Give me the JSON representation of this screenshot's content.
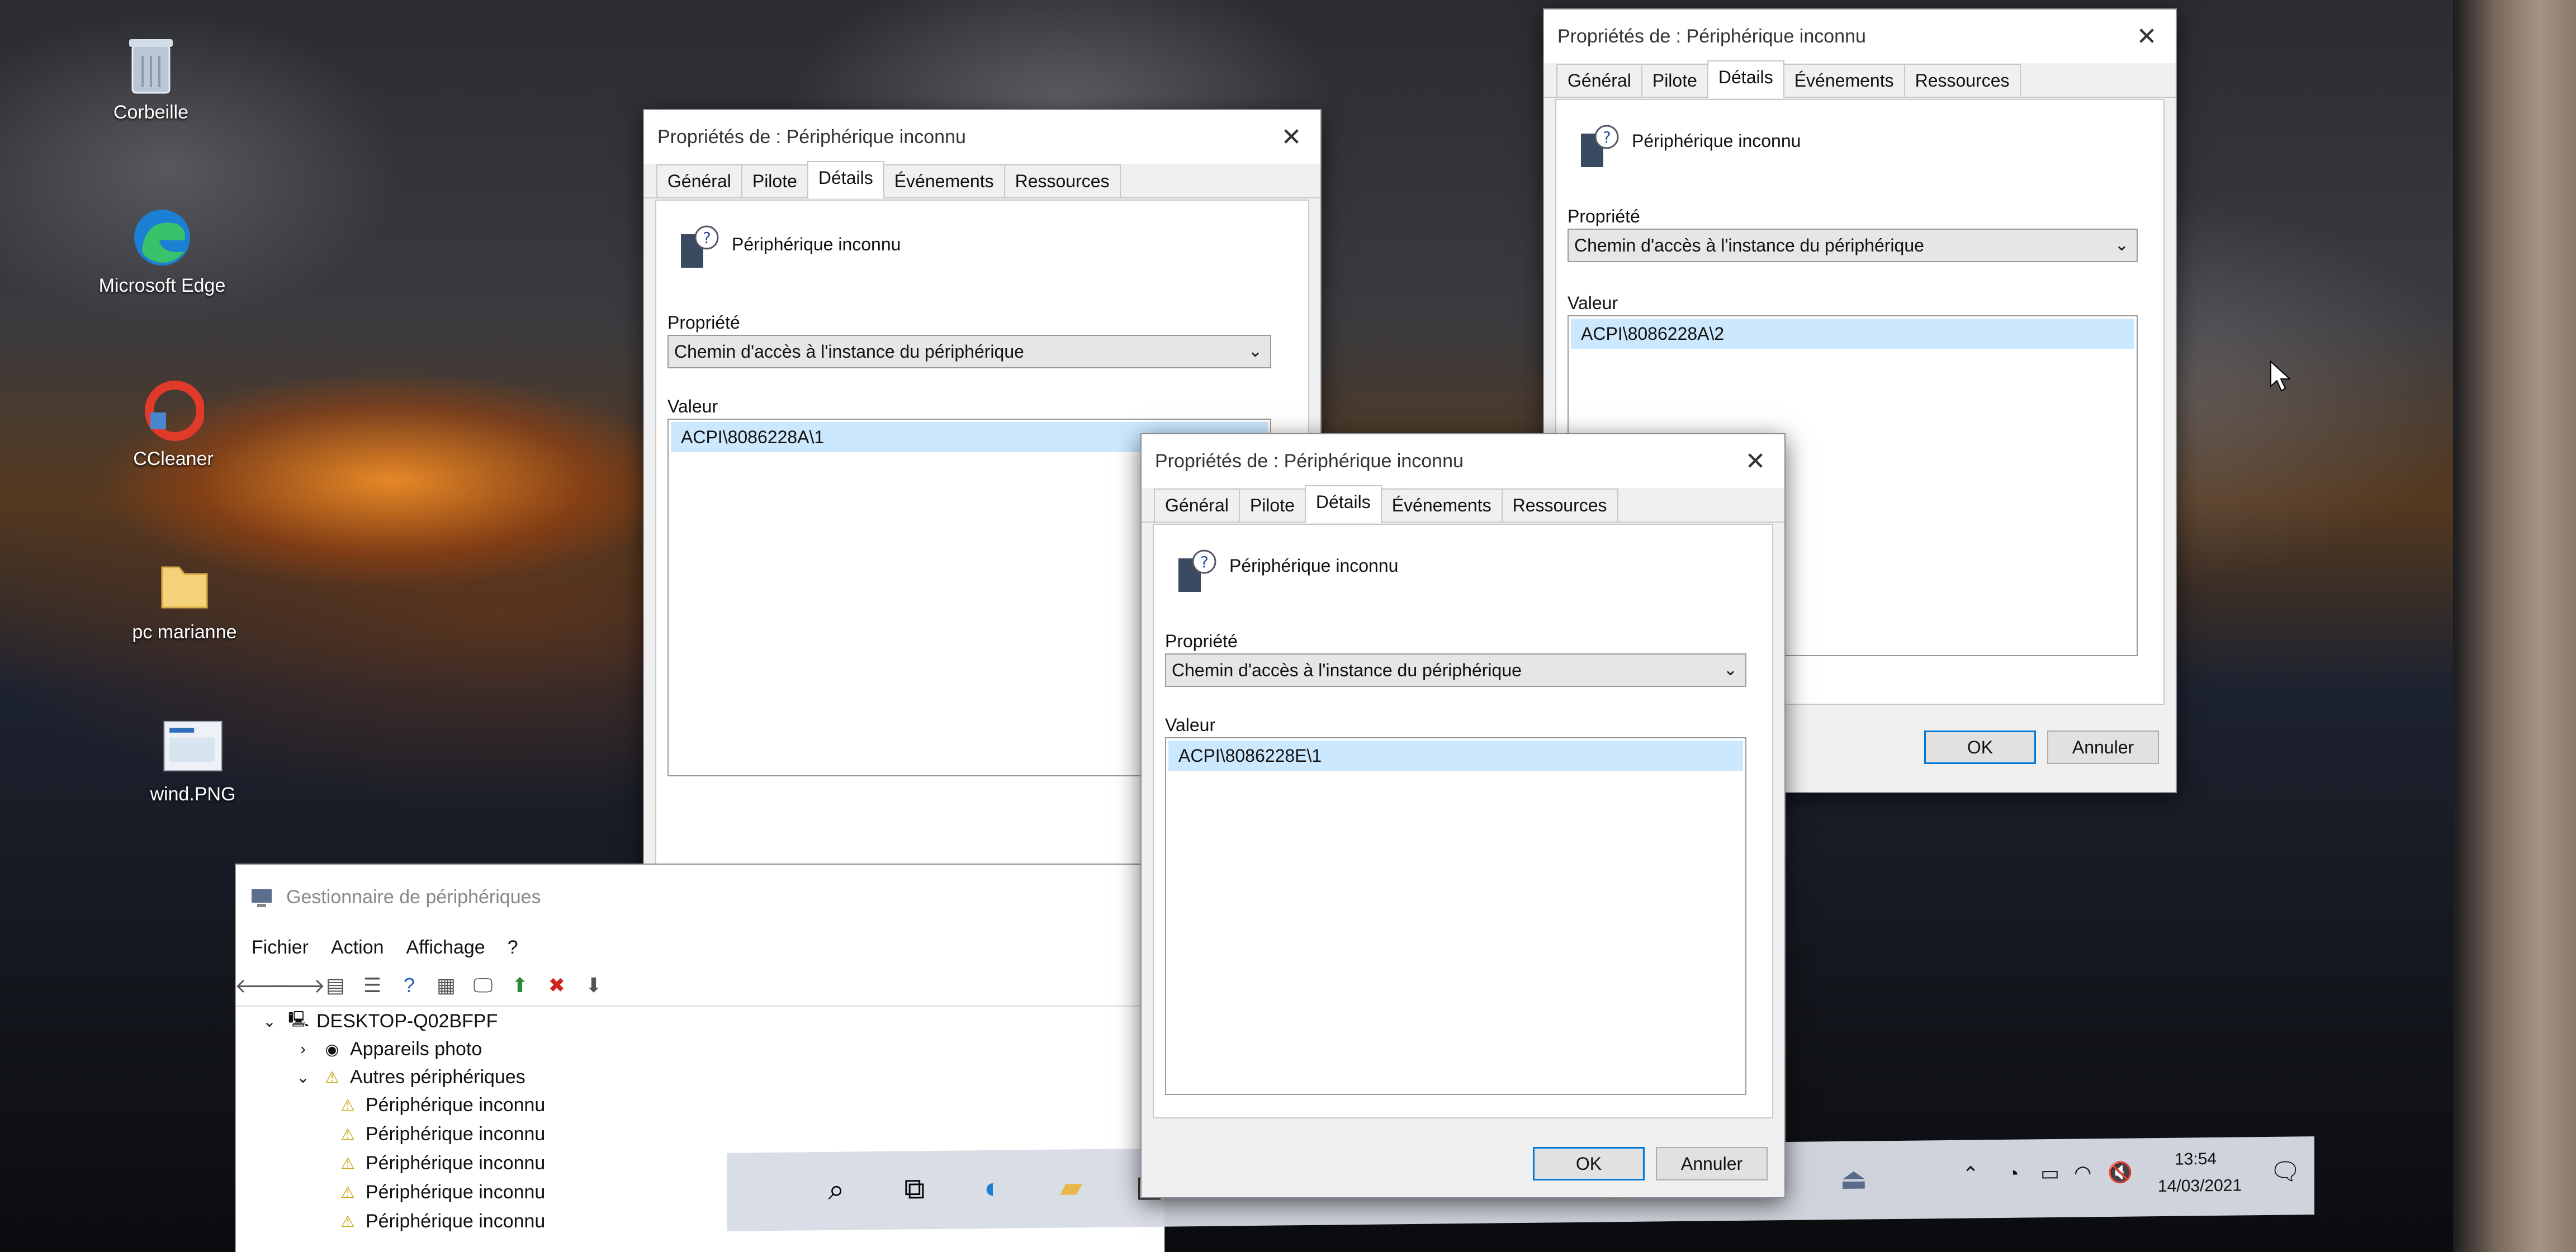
{
  "desktop": {
    "icons": [
      {
        "label": "Corbeille",
        "icon": "recycle-bin-icon"
      },
      {
        "label": "Microsoft Edge",
        "icon": "edge-icon"
      },
      {
        "label": "CCleaner",
        "icon": "ccleaner-icon"
      },
      {
        "label": "pc marianne",
        "icon": "folder-icon"
      },
      {
        "label": "wind.PNG",
        "icon": "image-file-icon"
      }
    ]
  },
  "dialogs": [
    {
      "title": "Propriétés de : Périphérique inconnu",
      "tabs": [
        "Général",
        "Pilote",
        "Détails",
        "Événements",
        "Ressources"
      ],
      "active_tab": "Détails",
      "device_name": "Périphérique inconnu",
      "property_label": "Propriété",
      "property_value": "Chemin d'accès à l'instance du périphérique",
      "value_label": "Valeur",
      "value": "ACPI\\8086228A\\1"
    },
    {
      "title": "Propriétés de : Périphérique inconnu",
      "tabs": [
        "Général",
        "Pilote",
        "Détails",
        "Événements",
        "Ressources"
      ],
      "active_tab": "Détails",
      "device_name": "Périphérique inconnu",
      "property_label": "Propriété",
      "property_value": "Chemin d'accès à l'instance du périphérique",
      "value_label": "Valeur",
      "value": "ACPI\\8086228A\\2",
      "ok_label": "OK",
      "cancel_label": "Annuler"
    },
    {
      "title": "Propriétés de : Périphérique inconnu",
      "tabs": [
        "Général",
        "Pilote",
        "Détails",
        "Événements",
        "Ressources"
      ],
      "active_tab": "Détails",
      "device_name": "Périphérique inconnu",
      "property_label": "Propriété",
      "property_value": "Chemin d'accès à l'instance du périphérique",
      "value_label": "Valeur",
      "value": "ACPI\\8086228E\\1",
      "ok_label": "OK",
      "cancel_label": "Annuler"
    }
  ],
  "device_manager": {
    "title": "Gestionnaire de périphériques",
    "menu": [
      "Fichier",
      "Action",
      "Affichage",
      "?"
    ],
    "tree": {
      "root": "DESKTOP-Q02BFPF",
      "cameras": "Appareils photo",
      "other_devices": "Autres périphériques",
      "unknown_devices": [
        "Périphérique inconnu",
        "Périphérique inconnu",
        "Périphérique inconnu",
        "Périphérique inconnu",
        "Périphérique inconnu"
      ]
    }
  },
  "taskbar": {
    "time": "13:54",
    "date": "14/03/2021"
  }
}
